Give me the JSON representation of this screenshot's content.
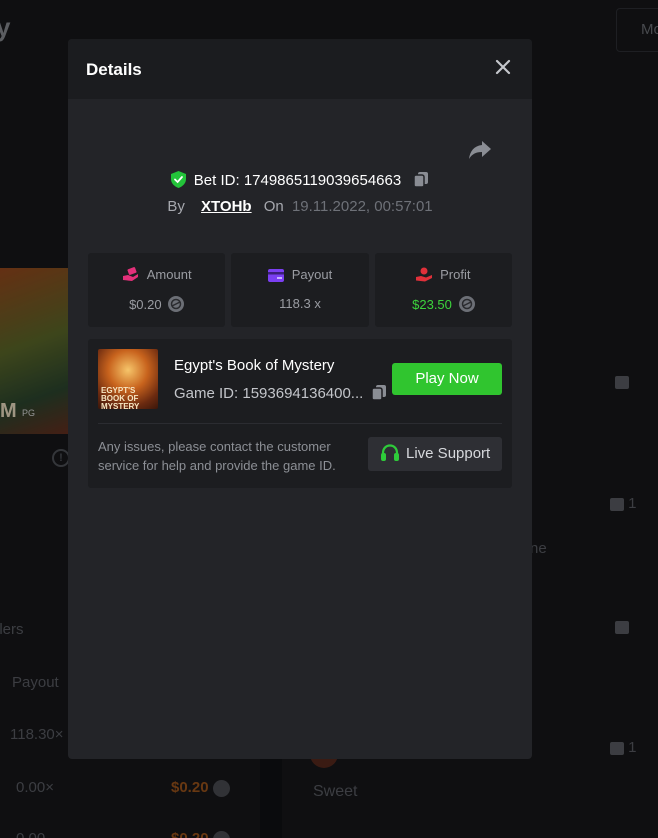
{
  "background": {
    "title_fragment": "y",
    "more_button": "Mo",
    "game_logo_text": "M",
    "game_brand": "PG",
    "column_label": "llers",
    "payout_header": "Payout",
    "rows": [
      {
        "payout": "118.30×",
        "amount": ""
      },
      {
        "payout": "0.00×",
        "amount": "$0.20"
      },
      {
        "payout": "0.00",
        "amount": "$0.20"
      }
    ],
    "likes": [
      "",
      "1",
      "",
      "1"
    ],
    "right_text_1": "ne",
    "right_text_2": "Sweet"
  },
  "modal": {
    "title": "Details",
    "bet_id_label": "Bet ID:",
    "bet_id": "1749865119039654663",
    "by_label": "By",
    "username": "XTOHb",
    "on_label": "On",
    "date": "19.11.2022, 00:57:01",
    "stats": {
      "amount": {
        "label": "Amount",
        "value": "$0.20"
      },
      "payout": {
        "label": "Payout",
        "value": "118.3 x"
      },
      "profit": {
        "label": "Profit",
        "value": "$23.50"
      }
    },
    "game": {
      "thumb_text": "EGYPT'S BOOK OF MYSTERY",
      "name": "Egypt's Book of Mystery",
      "id_label": "Game ID:",
      "id_value": "1593694136400...",
      "play_button": "Play Now"
    },
    "support": {
      "text": "Any issues, please contact the customer service for help and provide the game ID.",
      "button": "Live Support"
    }
  },
  "icons": {
    "close": "close-icon",
    "share": "share-icon",
    "shield": "shield-check-icon",
    "copy": "copy-icon",
    "amount": "amount-hand-icon",
    "payout": "card-icon",
    "profit": "profit-hand-icon",
    "coin": "coin-icon",
    "headset": "headset-icon"
  },
  "colors": {
    "accent_green": "#30c52f",
    "profit_green": "#3cd43c",
    "amount_pink": "#e3307a",
    "payout_purple": "#7b3ff2",
    "profit_red": "#e0303a"
  }
}
